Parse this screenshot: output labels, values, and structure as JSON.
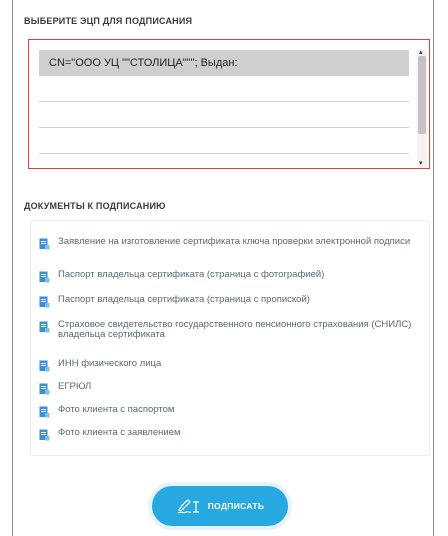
{
  "select_cert": {
    "title": "ВЫБЕРИТЕ ЭЦП ДЛЯ ПОДПИСАНИЯ",
    "certificates": [
      {
        "label": "CN=\"ООО УЦ \"\"СТОЛИЦА\"\"\"; Выдан:",
        "selected": true
      },
      {
        "label": "",
        "selected": false
      },
      {
        "label": "",
        "selected": false
      },
      {
        "label": "",
        "selected": false
      }
    ]
  },
  "documents": {
    "title": "ДОКУМЕНТЫ К ПОДПИСАНИЮ",
    "items": [
      "Заявление на изготовление сертификата ключа проверки электронной подписи",
      "Паспорт владельца сертификата (страница с фотографией)",
      "Паспорт владельца сертификата (страница с пропиской)",
      "Страховое свидетельство государственного пенсионного страхования (СНИЛС) владельца сертификата",
      "ИНН физического лица",
      "ЕГРЮЛ",
      "Фото клиента с паспортом",
      "Фото клиента с заявлением"
    ]
  },
  "sign_button": {
    "label": "ПОДПИСАТЬ"
  },
  "colors": {
    "accent": "#27a8e0",
    "error_border": "#e0403c",
    "doc_icon": "#3a8fd6"
  }
}
